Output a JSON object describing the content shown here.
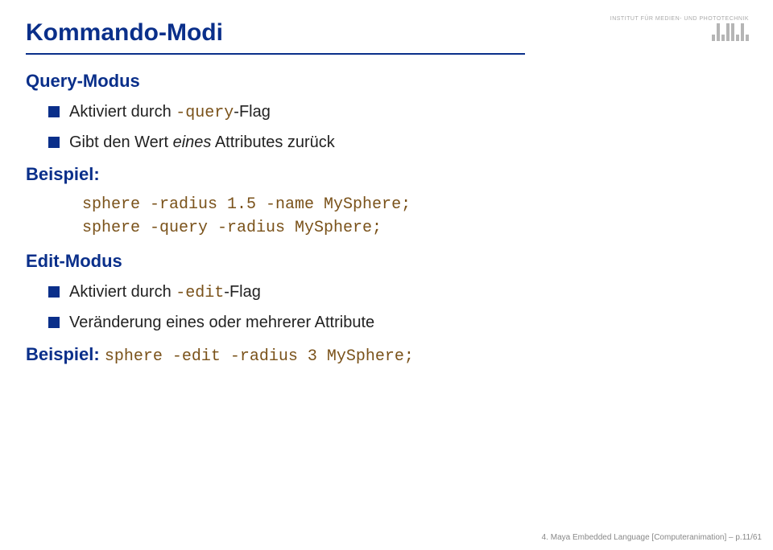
{
  "title": "Kommando-Modi",
  "section1": {
    "heading": "Query-Modus",
    "bullets": [
      {
        "pre": "Aktiviert durch ",
        "code": "-query",
        "post": "-Flag"
      },
      {
        "pre": "Gibt den Wert ",
        "italic": "eines",
        "post": " Attributes zurück"
      }
    ],
    "beispiel_label": "Beispiel:",
    "code": [
      "sphere -radius 1.5 -name MySphere;",
      "sphere -query -radius MySphere;"
    ]
  },
  "section2": {
    "heading": "Edit-Modus",
    "bullets": [
      {
        "pre": "Aktiviert durch ",
        "code": "-edit",
        "post": "-Flag"
      },
      {
        "pre": "Veränderung eines oder mehrerer Attribute"
      }
    ],
    "beispiel_label": "Beispiel:",
    "beispiel_code": "sphere -edit -radius 3 MySphere;"
  },
  "footer": "4. Maya Embedded Language [Computeranimation] – p.11/61",
  "logo_text": "INSTITUT FÜR MEDIEN- UND PHOTOTECHNIK"
}
